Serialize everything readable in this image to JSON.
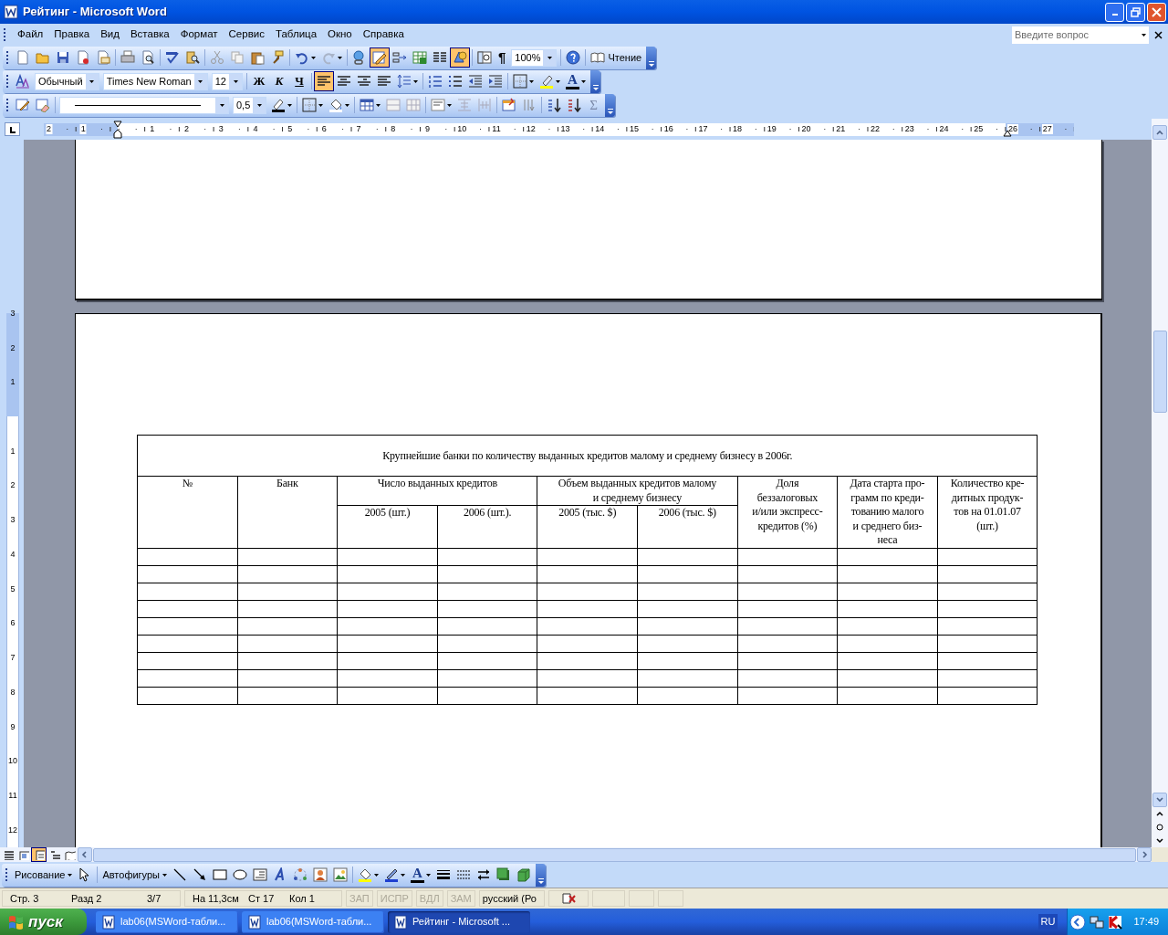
{
  "window": {
    "title": "Рейтинг - Microsoft Word"
  },
  "menu": [
    "Файл",
    "Правка",
    "Вид",
    "Вставка",
    "Формат",
    "Сервис",
    "Таблица",
    "Окно",
    "Справка"
  ],
  "help_box": {
    "placeholder": "Введите вопрос"
  },
  "standard_toolbar": {
    "tables_borders_pressed": true,
    "drawing_pressed": true,
    "marks_glyph": "¶",
    "zoom": "100%",
    "reading_button": "Чтение"
  },
  "formatting_toolbar": {
    "style": "Обычный",
    "font": "Times New Roman",
    "size": "12",
    "bold": "Ж",
    "italic": "К",
    "underline": "Ч",
    "alignment": [
      {
        "selected": true
      },
      {
        "selected": false
      },
      {
        "selected": false
      },
      {
        "selected": false
      }
    ],
    "font_color_glyph": "A"
  },
  "tables_toolbar": {
    "line_weight": "0,5",
    "sum_glyph": "Σ"
  },
  "ruler": {
    "left_labels": [
      "2",
      "1"
    ],
    "labels": [
      "1",
      "2",
      "3",
      "4",
      "5",
      "6",
      "7",
      "8",
      "9",
      "10",
      "11",
      "12",
      "13",
      "14",
      "15",
      "16",
      "17",
      "18",
      "19",
      "20",
      "21",
      "22",
      "23",
      "24",
      "25",
      "26",
      "27"
    ]
  },
  "vertical_ruler": {
    "top_labels": [
      "3",
      "2",
      "1"
    ],
    "labels": [
      "1",
      "2",
      "3",
      "4",
      "5",
      "6",
      "7",
      "8",
      "9",
      "10",
      "11",
      "12"
    ]
  },
  "table": {
    "caption": "Крупнейшие банки по количеству выданных кредитов малому и среднему бизнесу в 2006г.",
    "columns": [
      {
        "label": "№"
      },
      {
        "label": "Банк"
      },
      {
        "label": "Число выданных кредитов",
        "sub": [
          "2005 (шт.)",
          "2006 (шт.)."
        ]
      },
      {
        "label": "Объем выданных кредитов малому\nи среднему бизнесу",
        "sub": [
          "2005 (тыс. $)",
          "2006 (тыс. $)"
        ]
      },
      {
        "label": "Доля\nбеззалоговых\nи/или экспресс-\nкредитов (%)"
      },
      {
        "label": "Дата старта про-\nграмм по креди-\nтованию малого\nи среднего биз-\nнеса"
      },
      {
        "label": "Количество кре-\nдитных продук-\nтов на 01.01.07\n(шт.)"
      }
    ]
  },
  "view_buttons": [
    {
      "selected": false
    },
    {
      "selected": false
    },
    {
      "selected": true
    },
    {
      "selected": false
    },
    {
      "selected": false
    }
  ],
  "drawing_toolbar": {
    "draw_menu": "Рисование",
    "autoshapes_menu": "Автофигуры",
    "font_color_glyph": "A"
  },
  "status_bar": {
    "page": "Стр. 3",
    "section": "Разд 2",
    "pages": "3/7",
    "at": "На 11,3см",
    "line": "Ст 17",
    "column": "Кол 1",
    "modes": [
      {
        "label": "ЗАП",
        "on": false
      },
      {
        "label": "ИСПР",
        "on": false
      },
      {
        "label": "ВДЛ",
        "on": false
      },
      {
        "label": "ЗАМ",
        "on": false
      }
    ],
    "language": "русский (Ро"
  },
  "taskbar": {
    "start": "пуск",
    "tasks": [
      {
        "label": "lab06(MSWord-табли...",
        "selected": false
      },
      {
        "label": "lab06(MSWord-табли...",
        "selected": false
      },
      {
        "label": "Рейтинг - Microsoft ...",
        "selected": true
      }
    ],
    "language": "RU",
    "clock": "17:49"
  }
}
